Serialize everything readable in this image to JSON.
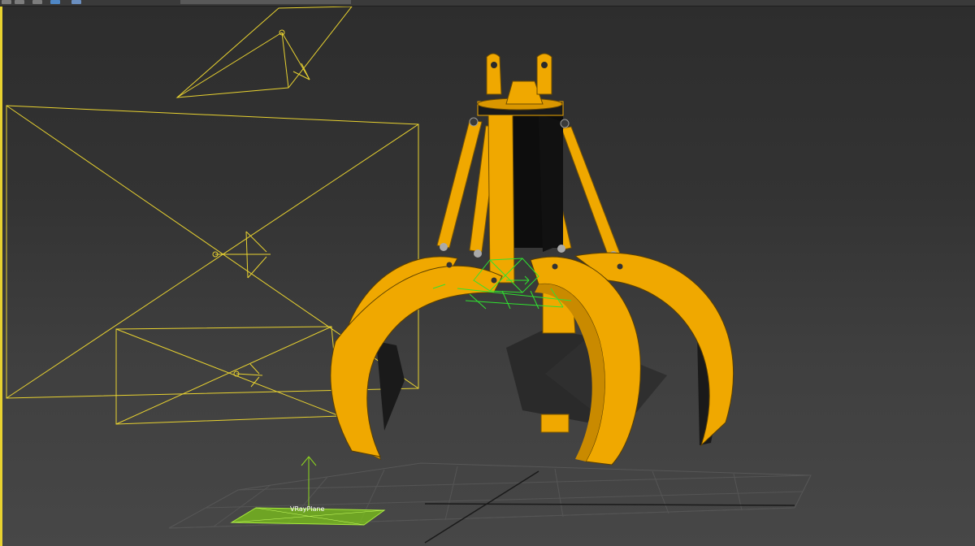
{
  "app": {
    "viewport_border_color": "#e8d230",
    "selection_color": "#e8d230",
    "helper_color": "#30e230"
  },
  "toolbar": {
    "icons": [
      "toolbar-icon",
      "toolbar-icon",
      "toolbar-icon",
      "toolbar-icon",
      "toolbar-icon"
    ]
  },
  "scene": {
    "objects": [
      {
        "name": "grab-claw-model",
        "color": "#f0a800"
      },
      {
        "name": "target-camera",
        "color": "#e8d230"
      },
      {
        "name": "vray-light-large",
        "color": "#e8d230"
      },
      {
        "name": "vray-light-small",
        "color": "#e8d230"
      },
      {
        "name": "vray-plane",
        "color": "#8ed81e"
      }
    ],
    "vray_plane_label": "VRayPlane"
  }
}
